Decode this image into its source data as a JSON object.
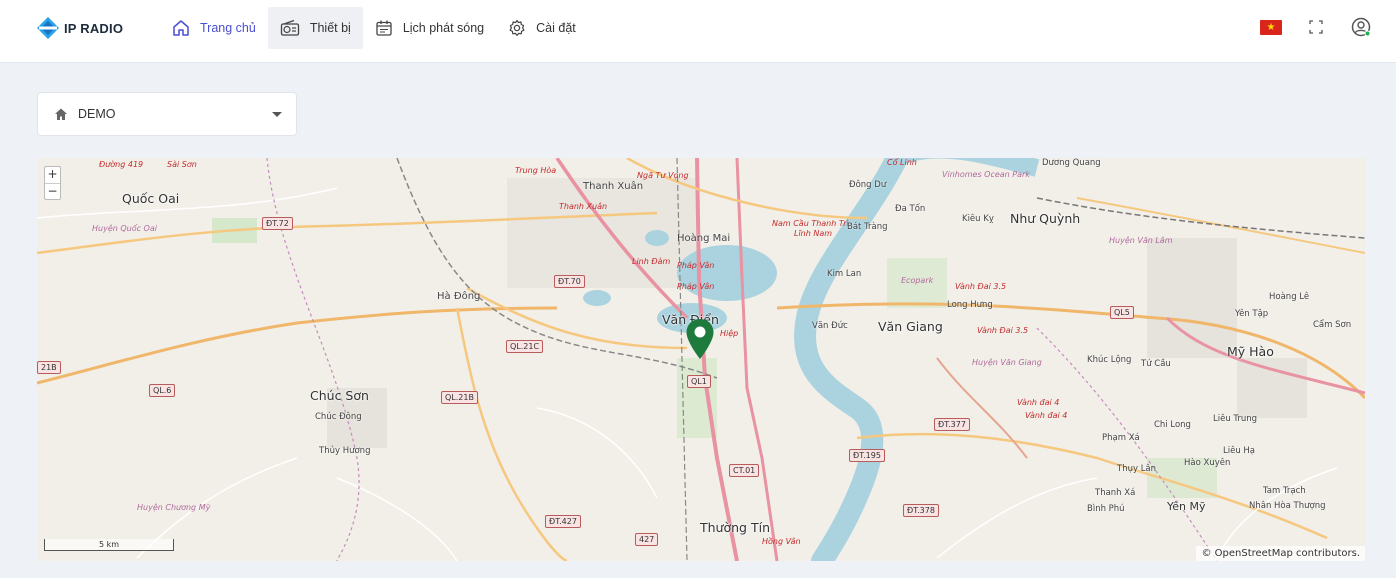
{
  "header": {
    "logo_text": "IP RADIO",
    "nav": [
      {
        "label": "Trang chủ",
        "icon": "home-icon"
      },
      {
        "label": "Thiết bị",
        "icon": "radio-icon"
      },
      {
        "label": "Lịch phát sóng",
        "icon": "calendar-icon"
      },
      {
        "label": "Cài đặt",
        "icon": "gear-icon"
      }
    ],
    "language_flag": "vietnam-flag-icon",
    "accent_color": "#4a4fd1"
  },
  "selector": {
    "value": "DEMO",
    "icon": "home-icon"
  },
  "map": {
    "zoom_in": "+",
    "zoom_out": "−",
    "scale": "5 km",
    "attribution": "© OpenStreetMap contributors.",
    "marker_color": "#1f7a3e",
    "labels": {
      "quoc_oai": "Quốc Oai",
      "huyen_quoc_oai": "Huyện Quốc Oai",
      "thanh_xuan": "Thanh Xuân",
      "thanh_xuan2": "Thanh Xuân",
      "trung_hoa": "Trung Hòa",
      "ngu_tu_vong": "Ngã Tư Vọng",
      "duong_419": "Đường 419",
      "sai_son": "Sài Sơn",
      "co_linh": "Cổ Linh",
      "duong_quang": "Dương Quang",
      "dong_du": "Đông Dư",
      "da_ton": "Đa Tốn",
      "kieu_ky": "Kiêu Kỵ",
      "nhu_quynh": "Như Quỳnh",
      "vinhomes": "Vinhomes Ocean Park",
      "hoang_mai": "Hoàng Mai",
      "nam_cau_thanh_tri": "Nam Cầu Thanh Trì",
      "linh_nam": "Lĩnh Nam",
      "bat_trang": "Bát Tràng",
      "huyen_van_lam": "Huyện Văn Lâm",
      "linh_dam": "Linh Đàm",
      "phap_van": "Pháp Vân",
      "phap_van2": "Pháp Vân",
      "kim_lan": "Kim Lan",
      "ecopark": "Ecopark",
      "vanh_dai_35": "Vành Đai 3.5",
      "long_hung": "Long Hưng",
      "ha_dong": "Hà Đông",
      "van_dien": "Văn Điển",
      "hiep": "Hiệp",
      "van_duc": "Văn Đức",
      "van_giang": "Văn Giang",
      "vanh_dai_35b": "Vành Đai 3.5",
      "hoang_le": "Hoàng Lê",
      "yen_tap": "Yên Tập",
      "cam_son": "Cẩm Sơn",
      "my_hao": "Mỹ Hào",
      "khuc_long": "Khúc Lộng",
      "tu_cau": "Tứ Cầu",
      "huyen_van_giang": "Huyện Văn Giang",
      "chuc_son": "Chúc Sơn",
      "chuc_dong": "Chúc Đông",
      "thuy_huong": "Thủy Hương",
      "vanh_dai_4": "Vành đai 4",
      "vanh_dai_4b": "Vành đai 4",
      "chi_long": "Chi Long",
      "lieu_trung": "Liêu Trung",
      "pham_xa": "Phạm Xá",
      "lieu_ha": "Liêu Hạ",
      "thuy_lan": "Thụy Lân",
      "hao_xuyen": "Hào Xuyên",
      "huyen_chuong_my": "Huyện Chương Mỹ",
      "thanh_xa": "Thanh Xá",
      "binh_phu": "Bình Phú",
      "yen_my": "Yên Mỹ",
      "tam_trach": "Tam Trạch",
      "nhan_hoa": "Nhân Hòa Thượng",
      "thuong_tin": "Thường Tín",
      "hong_van": "Hồng Vân"
    },
    "shields": {
      "dt72": "ĐT.72",
      "dt70": "ĐT.70",
      "ql21c": "QL.21C",
      "ql1": "QL1",
      "ql6": "QL.6",
      "ql21b": "QL.21B",
      "r21b": "21B",
      "ct01": "CT.01",
      "dt195": "ĐT.195",
      "dt377": "ĐT.377",
      "ql5": "QL5",
      "dt427": "ĐT.427",
      "r427": "427",
      "dt378": "ĐT.378"
    }
  }
}
